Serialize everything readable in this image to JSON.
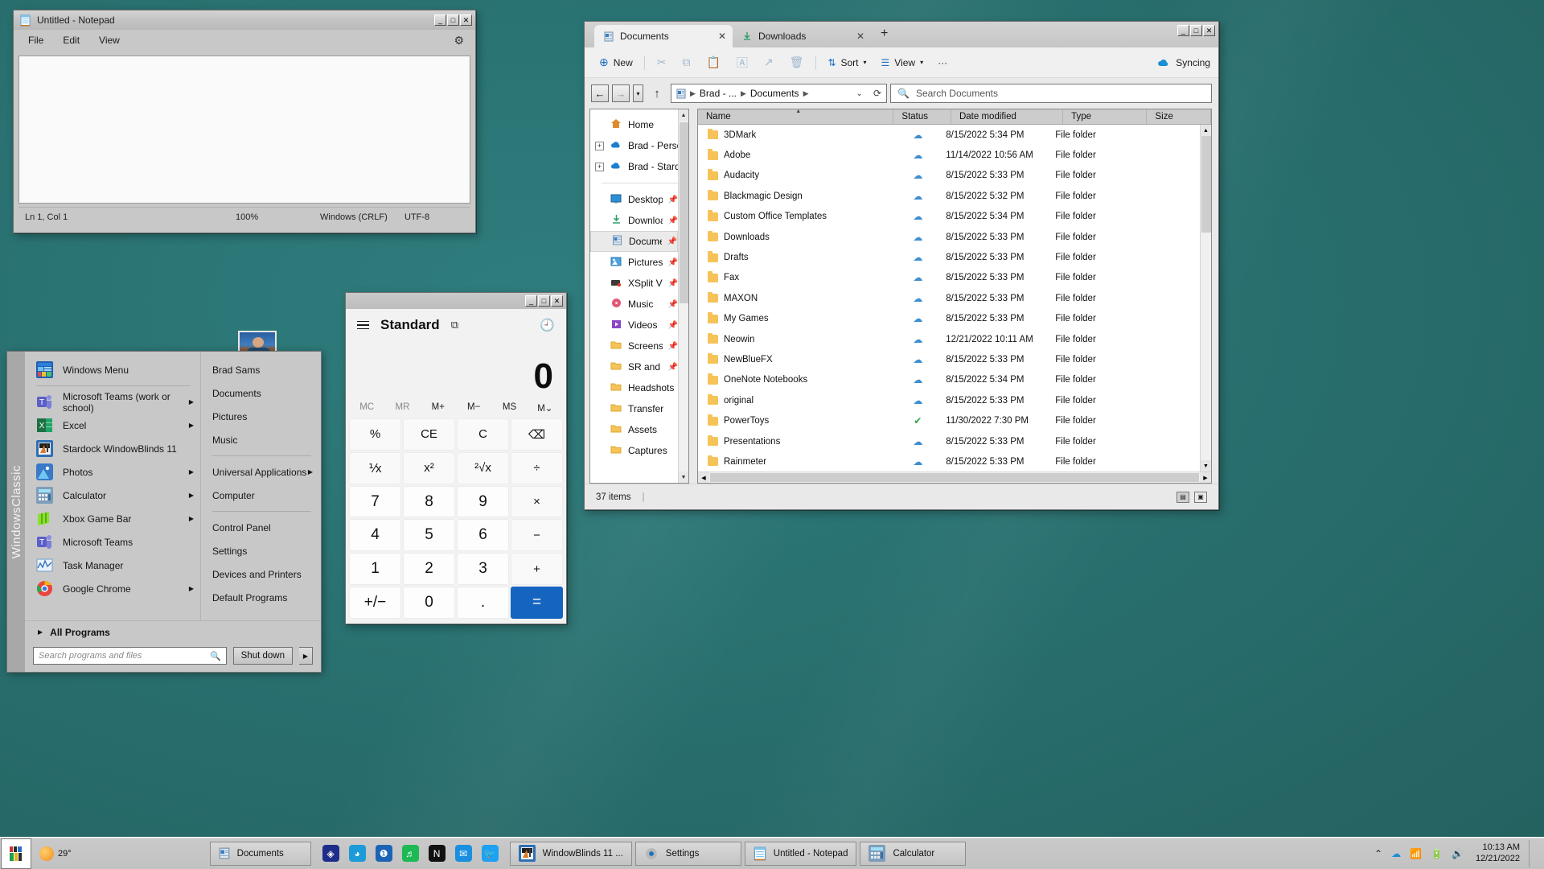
{
  "desktop": {
    "background_color": "#2a7272",
    "webcam_overlay_name": "webcam-thumbnail"
  },
  "notepad": {
    "title": "Untitled - Notepad",
    "icon": "notepad-icon",
    "menu": [
      "File",
      "Edit",
      "View"
    ],
    "settings_icon": "gear-icon",
    "content": "",
    "status": {
      "cursor": "Ln 1, Col 1",
      "zoom": "100%",
      "line_ending": "Windows (CRLF)",
      "encoding": "UTF-8"
    },
    "window_buttons": {
      "minimize": "_",
      "maximize": "□",
      "close": "✕"
    }
  },
  "calculator": {
    "title": "",
    "mode": "Standard",
    "menu_icon": "hamburger-icon",
    "keep_on_top_icon": "keep-on-top-icon",
    "history_icon": "history-icon",
    "display_value": "0",
    "memory_buttons": [
      "MC",
      "MR",
      "M+",
      "M−",
      "MS",
      "M⌄"
    ],
    "keys": [
      {
        "label": "%",
        "type": "fn"
      },
      {
        "label": "CE",
        "type": "fn"
      },
      {
        "label": "C",
        "type": "fn"
      },
      {
        "label": "⌫",
        "type": "fn"
      },
      {
        "label": "⅟x",
        "type": "fn"
      },
      {
        "label": "x²",
        "type": "fn"
      },
      {
        "label": "²√x",
        "type": "fn"
      },
      {
        "label": "÷",
        "type": "fn"
      },
      {
        "label": "7",
        "type": "num"
      },
      {
        "label": "8",
        "type": "num"
      },
      {
        "label": "9",
        "type": "num"
      },
      {
        "label": "×",
        "type": "fn"
      },
      {
        "label": "4",
        "type": "num"
      },
      {
        "label": "5",
        "type": "num"
      },
      {
        "label": "6",
        "type": "num"
      },
      {
        "label": "−",
        "type": "fn"
      },
      {
        "label": "1",
        "type": "num"
      },
      {
        "label": "2",
        "type": "num"
      },
      {
        "label": "3",
        "type": "num"
      },
      {
        "label": "+",
        "type": "fn"
      },
      {
        "label": "+/−",
        "type": "num"
      },
      {
        "label": "0",
        "type": "num"
      },
      {
        "label": ".",
        "type": "num"
      },
      {
        "label": "=",
        "type": "eq"
      }
    ],
    "window_buttons": {
      "minimize": "_",
      "maximize": "□",
      "close": "✕"
    }
  },
  "explorer": {
    "tabs": [
      {
        "label": "Documents",
        "icon": "documents-folder-icon",
        "active": true,
        "close": "✕"
      },
      {
        "label": "Downloads",
        "icon": "downloads-icon",
        "active": false,
        "close": "✕"
      }
    ],
    "new_tab_icon": "plus-icon",
    "window_buttons": {
      "minimize": "_",
      "maximize": "□",
      "close": "✕"
    },
    "toolbar": {
      "new_label": "New",
      "new_icon": "plus-circle-icon",
      "icon_buttons": [
        "cut-icon",
        "copy-icon",
        "paste-icon",
        "rename-icon",
        "share-icon",
        "delete-icon"
      ],
      "sort_label": "Sort",
      "sort_icon": "sort-icon",
      "view_label": "View",
      "view_icon": "view-icon",
      "more_label": "···",
      "sync_label": "Syncing",
      "sync_icon": "onedrive-sync-icon"
    },
    "nav": {
      "back_icon": "back-arrow-icon",
      "forward_icon": "forward-arrow-icon",
      "recent_icon": "chevron-down-icon",
      "up_icon": "up-arrow-icon",
      "breadcrumb": [
        "Brad - ...",
        "Documents"
      ],
      "breadcrumb_icon": "documents-folder-icon",
      "dropdown_icon": "chevron-down-icon",
      "refresh_icon": "refresh-icon",
      "search_placeholder": "Search Documents",
      "search_icon": "search-icon"
    },
    "sidebar": {
      "groups": [
        {
          "items": [
            {
              "label": "Home",
              "icon": "home-icon",
              "expander": "",
              "pin": false,
              "selected": false
            },
            {
              "label": "Brad - Personal",
              "icon": "onedrive-icon",
              "expander": "+",
              "pin": false,
              "selected": false
            },
            {
              "label": "Brad - Stardock C",
              "icon": "onedrive-icon",
              "expander": "+",
              "pin": false,
              "selected": false
            }
          ]
        },
        {
          "items": [
            {
              "label": "Desktop",
              "icon": "desktop-icon",
              "expander": "",
              "pin": true,
              "selected": false
            },
            {
              "label": "Downloads",
              "icon": "downloads-icon",
              "expander": "",
              "pin": true,
              "selected": false
            },
            {
              "label": "Documents",
              "icon": "documents-folder-icon",
              "expander": "",
              "pin": true,
              "selected": true
            },
            {
              "label": "Pictures",
              "icon": "pictures-icon",
              "expander": "",
              "pin": true,
              "selected": false
            },
            {
              "label": "XSplit Videos - ",
              "icon": "xsplit-icon",
              "expander": "",
              "pin": true,
              "selected": false
            },
            {
              "label": "Music",
              "icon": "music-icon",
              "expander": "",
              "pin": true,
              "selected": false
            },
            {
              "label": "Videos",
              "icon": "videos-icon",
              "expander": "",
              "pin": true,
              "selected": false
            },
            {
              "label": "Screenshots",
              "icon": "folder-icon",
              "expander": "",
              "pin": true,
              "selected": false
            },
            {
              "label": "SR and YT",
              "icon": "folder-icon",
              "expander": "",
              "pin": true,
              "selected": false
            },
            {
              "label": "Headshots",
              "icon": "folder-icon",
              "expander": "",
              "pin": false,
              "selected": false
            },
            {
              "label": "Transfer",
              "icon": "folder-icon",
              "expander": "",
              "pin": false,
              "selected": false
            },
            {
              "label": "Assets",
              "icon": "folder-icon",
              "expander": "",
              "pin": false,
              "selected": false
            },
            {
              "label": "Captures",
              "icon": "folder-icon",
              "expander": "",
              "pin": false,
              "selected": false
            }
          ]
        }
      ]
    },
    "columns": [
      "Name",
      "Status",
      "Date modified",
      "Type",
      "Size"
    ],
    "sorted_column": "Name",
    "rows": [
      {
        "name": "3DMark",
        "status": "cloud",
        "date": "8/15/2022 5:34 PM",
        "type": "File folder",
        "size": ""
      },
      {
        "name": "Adobe",
        "status": "cloud",
        "date": "11/14/2022 10:56 AM",
        "type": "File folder",
        "size": ""
      },
      {
        "name": "Audacity",
        "status": "cloud",
        "date": "8/15/2022 5:33 PM",
        "type": "File folder",
        "size": ""
      },
      {
        "name": "Blackmagic Design",
        "status": "cloud",
        "date": "8/15/2022 5:32 PM",
        "type": "File folder",
        "size": ""
      },
      {
        "name": "Custom Office Templates",
        "status": "cloud",
        "date": "8/15/2022 5:34 PM",
        "type": "File folder",
        "size": ""
      },
      {
        "name": "Downloads",
        "status": "cloud",
        "date": "8/15/2022 5:33 PM",
        "type": "File folder",
        "size": ""
      },
      {
        "name": "Drafts",
        "status": "cloud",
        "date": "8/15/2022 5:33 PM",
        "type": "File folder",
        "size": ""
      },
      {
        "name": "Fax",
        "status": "cloud",
        "date": "8/15/2022 5:33 PM",
        "type": "File folder",
        "size": ""
      },
      {
        "name": "MAXON",
        "status": "cloud",
        "date": "8/15/2022 5:33 PM",
        "type": "File folder",
        "size": ""
      },
      {
        "name": "My Games",
        "status": "cloud",
        "date": "8/15/2022 5:33 PM",
        "type": "File folder",
        "size": ""
      },
      {
        "name": "Neowin",
        "status": "cloud",
        "date": "12/21/2022 10:11 AM",
        "type": "File folder",
        "size": ""
      },
      {
        "name": "NewBlueFX",
        "status": "cloud",
        "date": "8/15/2022 5:33 PM",
        "type": "File folder",
        "size": ""
      },
      {
        "name": "OneNote Notebooks",
        "status": "cloud",
        "date": "8/15/2022 5:34 PM",
        "type": "File folder",
        "size": ""
      },
      {
        "name": "original",
        "status": "cloud",
        "date": "8/15/2022 5:33 PM",
        "type": "File folder",
        "size": ""
      },
      {
        "name": "PowerToys",
        "status": "synced",
        "date": "11/30/2022 7:30 PM",
        "type": "File folder",
        "size": ""
      },
      {
        "name": "Presentations",
        "status": "cloud",
        "date": "8/15/2022 5:33 PM",
        "type": "File folder",
        "size": ""
      },
      {
        "name": "Rainmeter",
        "status": "cloud",
        "date": "8/15/2022 5:33 PM",
        "type": "File folder",
        "size": ""
      }
    ],
    "status": {
      "item_count": "37 items",
      "view_details_icon": "details-view-icon",
      "view_tiles_icon": "tiles-view-icon"
    }
  },
  "start_menu": {
    "rail_label": "WindowsClassic",
    "left_items": [
      {
        "label": "Windows Menu",
        "icon": "windows-menu-icon",
        "arrow": false,
        "color": "#2b6fc7"
      },
      {
        "label": "Microsoft Teams (work or school)",
        "icon": "teams-icon",
        "arrow": true,
        "color": "#5b5fc7"
      },
      {
        "label": "Excel",
        "icon": "excel-icon",
        "arrow": true,
        "color": "#1d7044"
      },
      {
        "label": "Stardock WindowBlinds 11",
        "icon": "windowblinds-icon",
        "arrow": false,
        "color": "#2f6fb5"
      },
      {
        "label": "Photos",
        "icon": "photos-icon",
        "arrow": true,
        "color": "#4aa3e0"
      },
      {
        "label": "Calculator",
        "icon": "calculator-icon",
        "arrow": true,
        "color": "#7f9db9"
      },
      {
        "label": "Xbox Game Bar",
        "icon": "xbox-game-bar-icon",
        "arrow": true,
        "color": "#7ed321"
      },
      {
        "label": "Microsoft Teams",
        "icon": "teams-icon",
        "arrow": false,
        "color": "#5b5fc7"
      },
      {
        "label": "Task Manager",
        "icon": "task-manager-icon",
        "arrow": false,
        "color": "#4a7fb5"
      },
      {
        "label": "Google Chrome",
        "icon": "chrome-icon",
        "arrow": true,
        "color": "#e8453c"
      }
    ],
    "separator_after_index": 0,
    "all_programs": {
      "label": "All Programs",
      "icon": "chevron-right-icon"
    },
    "right_items": [
      {
        "label": "Brad Sams",
        "arrow": false
      },
      {
        "label": "Documents",
        "arrow": false
      },
      {
        "label": "Pictures",
        "arrow": false
      },
      {
        "label": "Music",
        "arrow": false
      },
      {
        "label": "Universal Applications",
        "arrow": true
      },
      {
        "label": "Computer",
        "arrow": false
      },
      {
        "label": "Control Panel",
        "arrow": false
      },
      {
        "label": "Settings",
        "arrow": false
      },
      {
        "label": "Devices and Printers",
        "arrow": false
      },
      {
        "label": "Default Programs",
        "arrow": false
      }
    ],
    "right_separator_after": [
      3,
      5
    ],
    "search_placeholder": "Search programs and files",
    "search_value": "",
    "search_icon": "search-icon",
    "shutdown_label": "Shut down",
    "shutdown_arrow_icon": "chevron-right-icon"
  },
  "taskbar": {
    "start_button_icon": "start-button-icon",
    "weather": {
      "temperature": "29°",
      "icon": "sun-icon"
    },
    "pinned_left": [
      {
        "label": "Documents",
        "icon": "documents-folder-icon"
      }
    ],
    "quick_icons": [
      {
        "name": "stardock-icon",
        "color": "#1f2d8a",
        "glyph": "◈"
      },
      {
        "name": "edge-icon",
        "color": "#1c9bd8",
        "glyph": "◕"
      },
      {
        "name": "fences-icon",
        "color": "#1b64b5",
        "glyph": "❶"
      },
      {
        "name": "spotify-icon",
        "color": "#1db954",
        "glyph": "♬"
      },
      {
        "name": "notion-icon",
        "color": "#111111",
        "glyph": "N"
      },
      {
        "name": "mail-icon",
        "color": "#1a8fe0",
        "glyph": "✉"
      },
      {
        "name": "twitter-icon",
        "color": "#1da1f2",
        "glyph": "🐦"
      }
    ],
    "tasks": [
      {
        "label": "WindowBlinds 11 ...",
        "icon": "windowblinds-icon"
      },
      {
        "label": "Settings",
        "icon": "settings-gear-icon"
      },
      {
        "label": "Untitled - Notepad",
        "icon": "notepad-icon"
      },
      {
        "label": "Calculator",
        "icon": "calculator-icon"
      }
    ],
    "tray_icons": [
      "chevron-up-icon",
      "onedrive-cloud-icon",
      "network-icon",
      "battery-icon",
      "volume-icon"
    ],
    "clock": {
      "time": "10:13 AM",
      "date": "12/21/2022"
    },
    "show_desktop": "show-desktop-button"
  }
}
